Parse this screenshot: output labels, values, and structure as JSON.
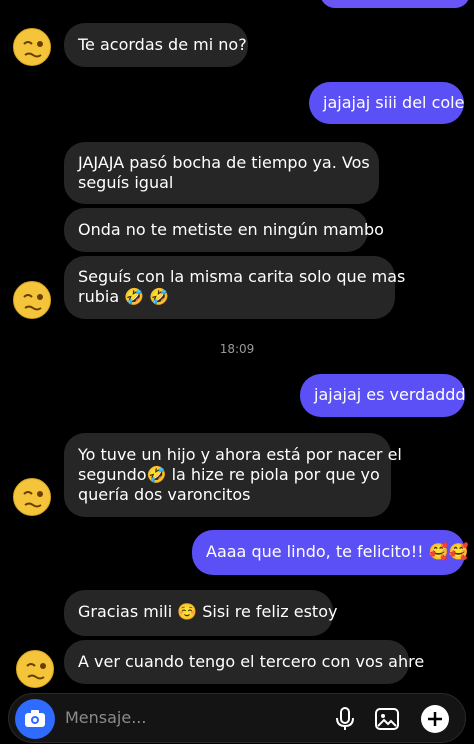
{
  "time_separator": "18:09",
  "composer": {
    "placeholder": "Mensaje..."
  },
  "messages": [
    {
      "lines": [
        "Te acordas de mi no?"
      ]
    },
    {
      "lines": [
        "jajajaj siii del cole"
      ]
    },
    {
      "lines": [
        "JAJAJA pasó bocha de tiempo ya. Vos",
        "seguís igual"
      ]
    },
    {
      "lines": [
        "Onda no te metiste en ningún mambo"
      ]
    },
    {
      "lines": [
        "Seguís con la misma carita solo que mas",
        "rubia 🤣 🤣"
      ]
    },
    {
      "lines": [
        "jajajaj es verdaddd"
      ]
    },
    {
      "lines": [
        "Yo tuve un hijo y ahora está por nacer el",
        "segundo🤣  la hize re piola por que yo",
        "quería dos varoncitos"
      ]
    },
    {
      "lines": [
        "Aaaa que lindo, te felicito!! 🥰🥰"
      ]
    },
    {
      "lines": [
        "Gracias mili  ☺️  Sisi re feliz estoy"
      ]
    },
    {
      "lines": [
        "A ver cuando tengo el tercero con vos ahre"
      ]
    }
  ],
  "icons": {
    "avatar": "woozy-face-emoji",
    "camera": "camera-icon",
    "mic": "microphone-icon",
    "gallery": "image-gallery-icon",
    "add": "plus-icon"
  },
  "colors": {
    "incoming_bubble": "#262626",
    "outgoing_bubble": "#5b50f5",
    "camera_button": "#2f6bff"
  }
}
